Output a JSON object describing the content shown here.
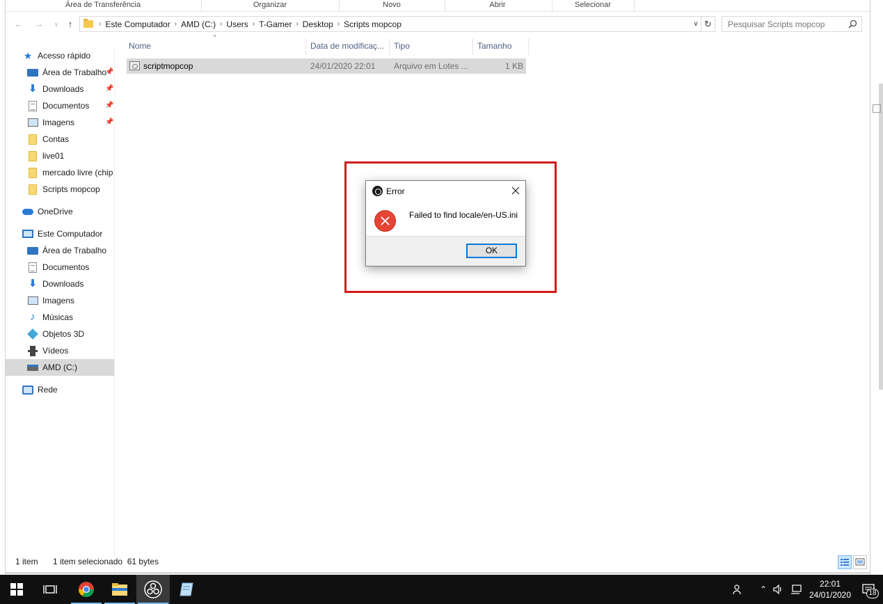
{
  "ribbon": {
    "groups": [
      "Área de Transferência",
      "Organizar",
      "Novo",
      "Abrir",
      "Selecionar"
    ]
  },
  "address": {
    "crumbs": [
      "Este Computador",
      "AMD (C:)",
      "Users",
      "T-Gamer",
      "Desktop",
      "Scripts mopcop"
    ],
    "search_placeholder": "Pesquisar Scripts mopcop"
  },
  "sidebar": {
    "quick_access": "Acesso rápido",
    "quick_items": [
      {
        "label": "Área de Trabalho",
        "icon": "desktop-icon",
        "pinned": true
      },
      {
        "label": "Downloads",
        "icon": "download-icon",
        "pinned": true
      },
      {
        "label": "Documentos",
        "icon": "document-icon",
        "pinned": true
      },
      {
        "label": "Imagens",
        "icon": "pictures-icon",
        "pinned": true
      },
      {
        "label": "Contas",
        "icon": "folder-icon",
        "pinned": false
      },
      {
        "label": "live01",
        "icon": "folder-icon",
        "pinned": false
      },
      {
        "label": "mercado livre (chip",
        "icon": "folder-icon",
        "pinned": false
      },
      {
        "label": "Scripts mopcop",
        "icon": "folder-icon",
        "pinned": false
      }
    ],
    "onedrive": "OneDrive",
    "this_pc": "Este Computador",
    "pc_items": [
      {
        "label": "Área de Trabalho",
        "icon": "desktop-icon"
      },
      {
        "label": "Documentos",
        "icon": "document-icon"
      },
      {
        "label": "Downloads",
        "icon": "download-icon"
      },
      {
        "label": "Imagens",
        "icon": "pictures-icon"
      },
      {
        "label": "Músicas",
        "icon": "music-icon"
      },
      {
        "label": "Objetos 3D",
        "icon": "objects-3d-icon"
      },
      {
        "label": "Vídeos",
        "icon": "videos-icon"
      },
      {
        "label": "AMD (C:)",
        "icon": "drive-icon"
      }
    ],
    "network": "Rede"
  },
  "file_list": {
    "columns": [
      "Nome",
      "Data de modificaç...",
      "Tipo",
      "Tamanho"
    ],
    "rows": [
      {
        "name": "scriptmopcop",
        "modified": "24/01/2020 22:01",
        "type": "Arquivo em Lotes ...",
        "size": "1 KB"
      }
    ]
  },
  "dialog": {
    "title": "Error",
    "message": "Failed to find locale/en-US.ini",
    "ok_label": "OK",
    "accent": "#d11a1a"
  },
  "status": {
    "count": "1 item",
    "selection": "1 item selecionado  61 bytes"
  },
  "taskbar": {
    "time": "22:01",
    "date": "24/01/2020",
    "notifications": "18"
  }
}
